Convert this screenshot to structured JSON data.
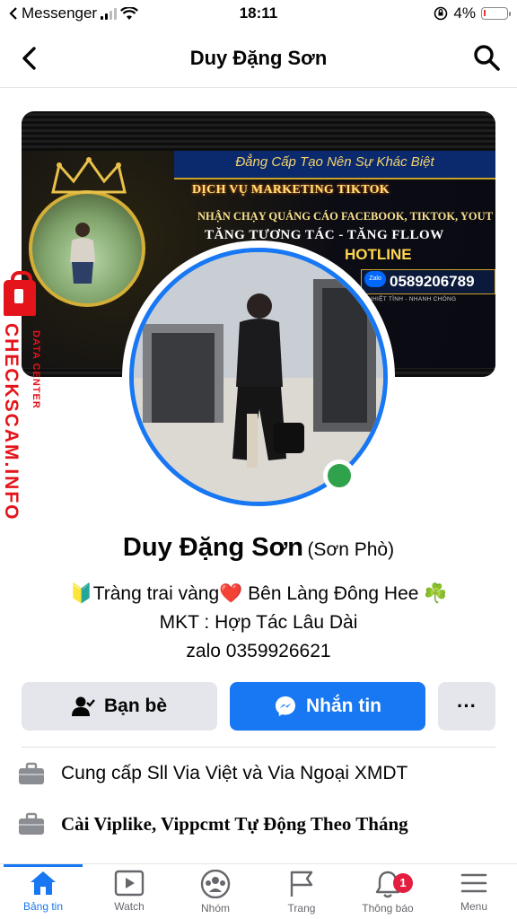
{
  "status_bar": {
    "carrier": "Messenger",
    "time": "18:11",
    "battery_percent": "4%"
  },
  "header": {
    "title": "Duy Đặng Sơn"
  },
  "cover": {
    "tagline": "Đẳng Cấp Tạo Nên Sự Khác Biệt",
    "service": "DỊCH VỤ MARKETING TIKTOK",
    "line1": "NHẬN CHẠY QUẢNG CÁO FACEBOOK, TIKTOK, YOUT",
    "line2": "TĂNG TƯƠNG TÁC - TĂNG FLLOW",
    "hotline_label": "HOTLINE",
    "zalo_label": "Zalo",
    "phone": "0589206789",
    "sub": "NHIỆT TÌNH - NHANH CHÓNG"
  },
  "watermark": {
    "main": "CHECKSCAM.INFO",
    "sub": "DATA CENTER"
  },
  "profile": {
    "name": "Duy Đặng Sơn",
    "alt_name": "(Sơn Phò)",
    "bio": [
      "🔰Tràng trai vàng❤️ Bên Làng Đông Hee ☘️",
      "MKT : Hợp Tác Lâu Dài",
      "zalo 0359926621"
    ]
  },
  "actions": {
    "friends": "Bạn bè",
    "message": "Nhắn tin",
    "more": "···"
  },
  "info": [
    "Cung cấp Sll Via Việt và Via Ngoại XMDT",
    "Cài Viplike, Vippcmt Tự Động Theo Tháng"
  ],
  "nav": {
    "items": [
      {
        "label": "Bảng tin"
      },
      {
        "label": "Watch"
      },
      {
        "label": "Nhóm"
      },
      {
        "label": "Trang"
      },
      {
        "label": "Thông báo",
        "badge": "1"
      },
      {
        "label": "Menu"
      }
    ]
  },
  "colors": {
    "accent": "#1877f2",
    "online": "#31a24c",
    "badge": "#e41e3f",
    "watermark": "#e4141b"
  }
}
